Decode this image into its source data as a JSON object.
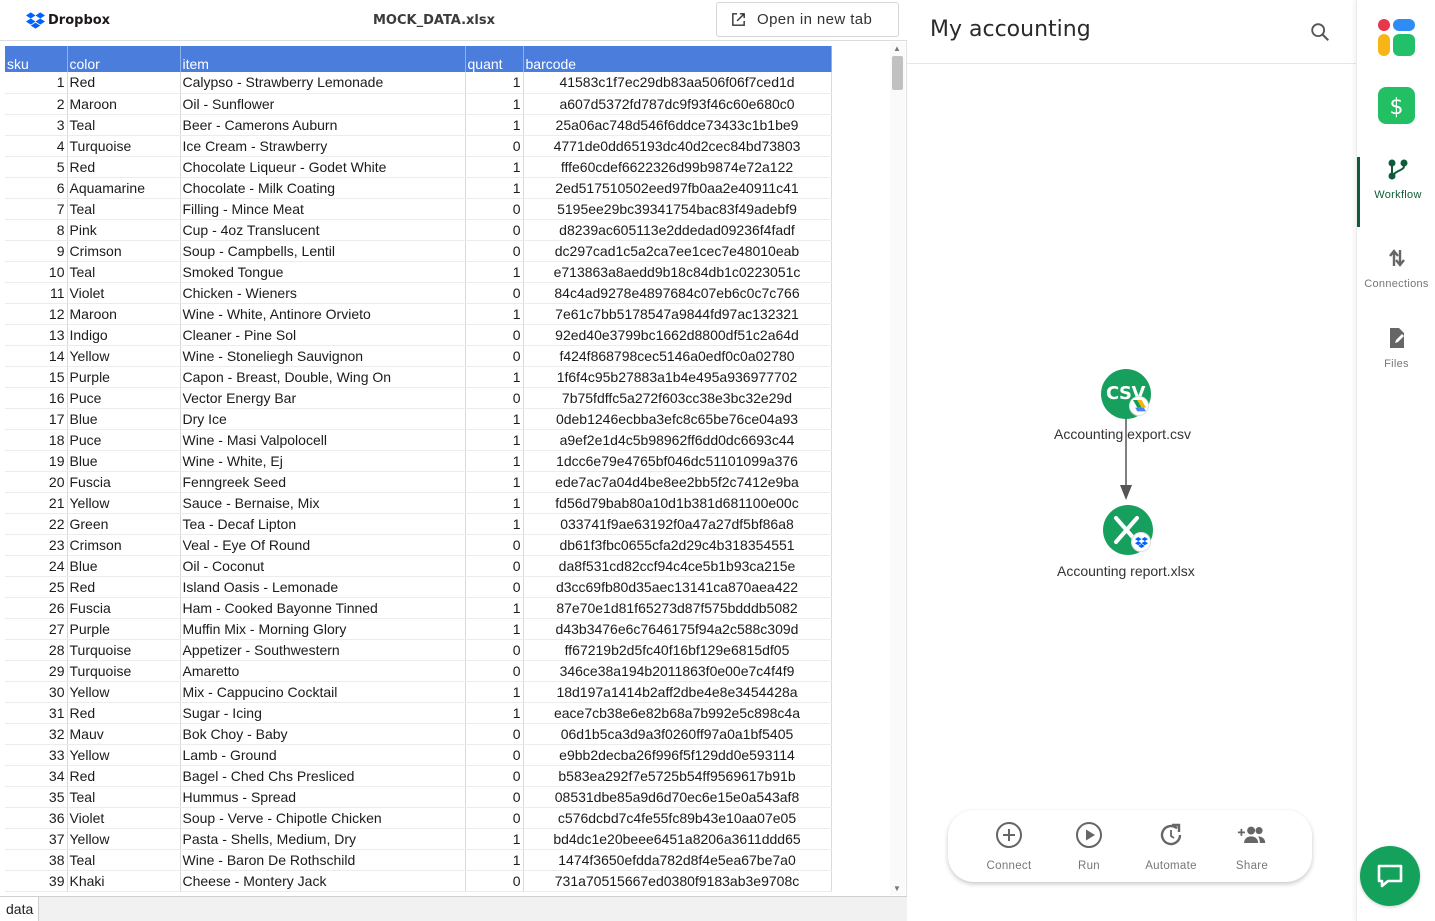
{
  "viewer": {
    "brand": "Dropbox",
    "filename": "MOCK_DATA.xlsx",
    "open_tab_label": "Open in new tab",
    "sheet_tab": "data",
    "columns": [
      "sku",
      "color",
      "item",
      "quant",
      "barcode"
    ],
    "rows": [
      [
        "1",
        "Red",
        "Calypso - Strawberry Lemonade",
        "1",
        "41583c1f7ec29db83aa506f06f7ced1d"
      ],
      [
        "2",
        "Maroon",
        "Oil - Sunflower",
        "1",
        "a607d5372fd787dc9f93f46c60e680c0"
      ],
      [
        "3",
        "Teal",
        "Beer - Camerons Auburn",
        "1",
        "25a06ac748d546f6ddce73433c1b1be9"
      ],
      [
        "4",
        "Turquoise",
        "Ice Cream - Strawberry",
        "0",
        "4771de0dd65193dc40d2cec84bd73803"
      ],
      [
        "5",
        "Red",
        "Chocolate Liqueur - Godet White",
        "1",
        "fffe60cdef6622326d99b9874e72a122"
      ],
      [
        "6",
        "Aquamarine",
        "Chocolate - Milk Coating",
        "1",
        "2ed517510502eed97fb0aa2e40911c41"
      ],
      [
        "7",
        "Teal",
        "Filling - Mince Meat",
        "0",
        "5195ee29bc39341754bac83f49adebf9"
      ],
      [
        "8",
        "Pink",
        "Cup - 4oz Translucent",
        "0",
        "d8239ac605113e2ddedad09236f4fadf"
      ],
      [
        "9",
        "Crimson",
        "Soup - Campbells, Lentil",
        "0",
        "dc297cad1c5a2ca7ee1cec7e48010eab"
      ],
      [
        "10",
        "Teal",
        "Smoked Tongue",
        "1",
        "e713863a8aedd9b18c84db1c0223051c"
      ],
      [
        "11",
        "Violet",
        "Chicken - Wieners",
        "0",
        "84c4ad9278e4897684c07eb6c0c7c766"
      ],
      [
        "12",
        "Maroon",
        "Wine - White, Antinore Orvieto",
        "1",
        "7e61c7bb5178547a9844fd97ac132321"
      ],
      [
        "13",
        "Indigo",
        "Cleaner - Pine Sol",
        "0",
        "92ed40e3799bc1662d8800df51c2a64d"
      ],
      [
        "14",
        "Yellow",
        "Wine - Stoneliegh Sauvignon",
        "0",
        "f424f868798cec5146a0edf0c0a02780"
      ],
      [
        "15",
        "Purple",
        "Capon - Breast, Double, Wing On",
        "1",
        "1f6f4c95b27883a1b4e495a936977702"
      ],
      [
        "16",
        "Puce",
        "Vector Energy Bar",
        "0",
        "7b75fdffc5a272f603cc38e3bc32e29d"
      ],
      [
        "17",
        "Blue",
        "Dry Ice",
        "1",
        "0deb1246ecbba3efc8c65be76ce04a93"
      ],
      [
        "18",
        "Puce",
        "Wine - Masi Valpolocell",
        "1",
        "a9ef2e1d4c5b98962ff6dd0dc6693c44"
      ],
      [
        "19",
        "Blue",
        "Wine - White, Ej",
        "1",
        "1dcc6e79e4765bf046dc51101099a376"
      ],
      [
        "20",
        "Fuscia",
        "Fenngreek Seed",
        "1",
        "ede7ac7a04d4be8ee2bb5f2c7412e9ba"
      ],
      [
        "21",
        "Yellow",
        "Sauce - Bernaise, Mix",
        "1",
        "fd56d79bab80a10d1b381d681100e00c"
      ],
      [
        "22",
        "Green",
        "Tea - Decaf Lipton",
        "1",
        "033741f9ae63192f0a47a27df5bf86a8"
      ],
      [
        "23",
        "Crimson",
        "Veal - Eye Of Round",
        "0",
        "db61f3fbc0655cfa2d29c4b318354551"
      ],
      [
        "24",
        "Blue",
        "Oil - Coconut",
        "0",
        "da8f531cd82ccf94c4ce5b1b93ca215e"
      ],
      [
        "25",
        "Red",
        "Island Oasis - Lemonade",
        "0",
        "d3cc69fb80d35aec13141ca870aea422"
      ],
      [
        "26",
        "Fuscia",
        "Ham - Cooked Bayonne Tinned",
        "1",
        "87e70e1d81f65273d87f575bdddb5082"
      ],
      [
        "27",
        "Purple",
        "Muffin Mix - Morning Glory",
        "1",
        "d43b3476e6c7646175f94a2c588c309d"
      ],
      [
        "28",
        "Turquoise",
        "Appetizer - Southwestern",
        "0",
        "ff67219b2d5fc40f16bf129e6815df05"
      ],
      [
        "29",
        "Turquoise",
        "Amaretto",
        "0",
        "346ce38a194b2011863f0e00e7c4f4f9"
      ],
      [
        "30",
        "Yellow",
        "Mix - Cappucino Cocktail",
        "1",
        "18d197a1414b2aff2dbe4e8e3454428a"
      ],
      [
        "31",
        "Red",
        "Sugar - Icing",
        "1",
        "eace7cb38e6e82b68a7b992e5c898c4a"
      ],
      [
        "32",
        "Mauv",
        "Bok Choy - Baby",
        "0",
        "06d1b5ca3d9a3f0260ff97a0a1bf5405"
      ],
      [
        "33",
        "Yellow",
        "Lamb - Ground",
        "0",
        "e9bb2decba26f996f5f129dd0e593114"
      ],
      [
        "34",
        "Red",
        "Bagel - Ched Chs Presliced",
        "0",
        "b583ea292f7e5725b54ff9569617b91b"
      ],
      [
        "35",
        "Teal",
        "Hummus - Spread",
        "0",
        "08531dbe85a9d6d70ec6e15e0a543af8"
      ],
      [
        "36",
        "Violet",
        "Soup - Verve - Chipotle Chicken",
        "0",
        "c576dcbd7c4fe55fc89b43e10aa07e05"
      ],
      [
        "37",
        "Yellow",
        "Pasta - Shells, Medium, Dry",
        "1",
        "bd4dc1e20beee6451a8206a3611ddd65"
      ],
      [
        "38",
        "Teal",
        "Wine - Baron De Rothschild",
        "1",
        "1474f3650efdda782d8f4e5ea67be7a0"
      ],
      [
        "39",
        "Khaki",
        "Cheese - Montery Jack",
        "0",
        "731a70515667ed0380f9183ab3e9708c"
      ]
    ]
  },
  "workflow": {
    "title": "My accounting",
    "nodes": [
      {
        "label": "Accounting export.csv",
        "icon_text": "CSV",
        "badge": "google-drive-icon"
      },
      {
        "label": "Accounting report.xlsx",
        "icon_text": "",
        "badge": "dropbox-icon"
      }
    ],
    "actions": [
      {
        "label": "Connect",
        "icon": "plus-circle-icon"
      },
      {
        "label": "Run",
        "icon": "play-circle-icon"
      },
      {
        "label": "Automate",
        "icon": "refresh-icon"
      },
      {
        "label": "Share",
        "icon": "add-people-icon"
      }
    ],
    "colors": {
      "node": "#17a05d",
      "header": "#4a7ddc",
      "active_nav": "#0f5c3a"
    }
  },
  "rail": {
    "apps": [
      {
        "name": "apps-grid-icon"
      },
      {
        "name": "dollar-icon"
      }
    ],
    "nav": [
      {
        "label": "Workflow",
        "icon": "workflow-icon",
        "active": true
      },
      {
        "label": "Connections",
        "icon": "connections-icon",
        "active": false
      },
      {
        "label": "Files",
        "icon": "file-edit-icon",
        "active": false
      }
    ]
  }
}
